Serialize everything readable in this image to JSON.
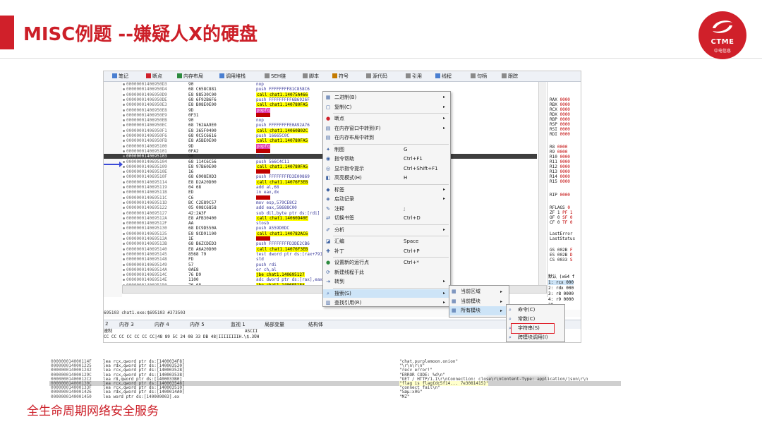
{
  "slide": {
    "title": "MISC例题 --嫌疑人X的硬盘",
    "footer": "全生命周期网络安全服务",
    "logo_name": "CTME",
    "logo_sub": "中电信息",
    "accent": "#cc1f28"
  },
  "toolbar": {
    "tabs": [
      {
        "label": "笔记",
        "color": "#4a7fd1"
      },
      {
        "label": "断点",
        "color": "#d0202a"
      },
      {
        "label": "内存布局",
        "color": "#2c8a3e"
      },
      {
        "label": "调用堆栈",
        "color": "#4a7fd1"
      },
      {
        "label": "SEH链",
        "color": "#8a8a8a"
      },
      {
        "label": "脚本",
        "color": "#8a8a8a"
      },
      {
        "label": "符号",
        "color": "#c47a00"
      },
      {
        "label": "源代码",
        "color": "#8a8a8a"
      },
      {
        "label": "引用",
        "color": "#8a8a8a"
      },
      {
        "label": "线程",
        "color": "#4a7fd1"
      },
      {
        "label": "句柄",
        "color": "#8a8a8a"
      },
      {
        "label": "跟踪",
        "color": "#8a8a8a"
      }
    ]
  },
  "disasm": {
    "rows": [
      {
        "addr": "00000001406950D3",
        "bytes": "90",
        "ins": "nop"
      },
      {
        "addr": "00000001406950D4",
        "bytes": "68 C658C881",
        "ins": "push FFFFFFFF81C858C6"
      },
      {
        "addr": "00000001406950D9",
        "bytes": "E8 88530C00",
        "ins": "call chat1.14075A466",
        "call": true
      },
      {
        "addr": "00000001406950DE",
        "bytes": "68 6F92B6F6",
        "ins": "push FFFFFFFFF6B6926F"
      },
      {
        "addr": "00000001406950E3",
        "bytes": "E8 B08E0E00",
        "ins": "call chat1.140780FA5",
        "call": true
      },
      {
        "addr": "00000001406950E8",
        "bytes": "9D",
        "ins": "popfq",
        "pop": true
      },
      {
        "addr": "00000001406950E9",
        "bytes": "0F31",
        "ins": "",
        "block": true
      },
      {
        "addr": "00000001406950EB",
        "bytes": "90",
        "ins": "nop"
      },
      {
        "addr": "00000001406950EC",
        "bytes": "68 762AA9E0",
        "ins": "push FFFFFFFFE0A92A76"
      },
      {
        "addr": "00000001406950F1",
        "bytes": "E8 365F0400",
        "ins": "call chat1.14060B02C",
        "call": true
      },
      {
        "addr": "00000001406950F6",
        "bytes": "68 0C5C6616",
        "ins": "push 16665C0C"
      },
      {
        "addr": "00000001406950FB",
        "bytes": "E8 A5BE0E00",
        "ins": "call chat1.140780FA5",
        "call": true
      },
      {
        "addr": "0000000140695100",
        "bytes": "9D",
        "ins": "popfq",
        "pop": true
      },
      {
        "addr": "0000000140695101",
        "bytes": "0FA2",
        "ins": "",
        "block": true
      },
      {
        "addr": "0000000140695103",
        "bytes": "90",
        "ins": "nop",
        "sel": true
      },
      {
        "addr": "0000000140695104",
        "bytes": "68 114C6C56",
        "ins": "push 566C4C11"
      },
      {
        "addr": "0000000140695109",
        "bytes": "E8 97B60E00",
        "ins": "call chat1.140780FA5",
        "call": true
      },
      {
        "addr": "000000014069510E",
        "bytes": "16",
        "ins": "",
        "block": true
      },
      {
        "addr": "000000014069510F",
        "bytes": "68 6908E0D3",
        "ins": "push FFFFFFFFD3E00869"
      },
      {
        "addr": "0000000140695114",
        "bytes": "E8 D2A20D00",
        "ins": "call chat1.14076F3EB",
        "call": true
      },
      {
        "addr": "0000000140695119",
        "bytes": "04 68",
        "ins": "add al,68"
      },
      {
        "addr": "000000014069511B",
        "bytes": "ED",
        "ins": "in eax,dx"
      },
      {
        "addr": "000000014069511C",
        "bytes": "C6",
        "ins": "",
        "block": true
      },
      {
        "addr": "000000014069511D",
        "bytes": "BC C2E89C57",
        "ins": "mov esp,579CE8C2"
      },
      {
        "addr": "0000000140695122",
        "bytes": "05 008C6858",
        "ins": "add eax,58688C00"
      },
      {
        "addr": "0000000140695127",
        "bytes": "42:2A3F",
        "ins": "sub dil,byte ptr ds:[rdi]"
      },
      {
        "addr": "000000014069512A",
        "bytes": "E8 AFB30400",
        "ins": "call chat1.14060D40E",
        "call": true
      },
      {
        "addr": "000000014069512F",
        "bytes": "AA",
        "ins": "stosb"
      },
      {
        "addr": "0000000140695130",
        "bytes": "68 DC9D550A",
        "ins": "push A559D0DC"
      },
      {
        "addr": "0000000140695135",
        "bytes": "E8 8CD91100",
        "ins": "call chat1.140782AC6",
        "call": true
      },
      {
        "addr": "000000014069513A",
        "bytes": "1E",
        "ins": "",
        "block": true
      },
      {
        "addr": "000000014069513B",
        "bytes": "68 B6ZCDED3",
        "ins": "push FFFFFFFFD3DE2CB6"
      },
      {
        "addr": "0000000140695140",
        "bytes": "E8 A6A20D00",
        "ins": "call chat1.14076F3EB",
        "call": true
      },
      {
        "addr": "0000000140695145",
        "bytes": "8568 79",
        "ins": "test dword ptr ds:[rax+79],ebp"
      },
      {
        "addr": "0000000140695148",
        "bytes": "FD",
        "ins": "std"
      },
      {
        "addr": "0000000140695149",
        "bytes": "57",
        "ins": "push rdi"
      },
      {
        "addr": "000000014069514A",
        "bytes": "0AE8",
        "ins": "or ch,al"
      },
      {
        "addr": "000000014069514C",
        "bytes": "76 D9",
        "ins": "jbe chat1.140695127",
        "jmp": true
      },
      {
        "addr": "000000014069514E",
        "bytes": "1100",
        "ins": "adc dword ptr ds:[rax],eax"
      },
      {
        "addr": "0000000140695150",
        "bytes": "76 68",
        "ins": "jbe chat1.14069518A",
        "jmp": true
      },
      {
        "addr": "0000000140695152",
        "bytes": "8A 17B7B6E8",
        "ins": "mov edx,E8B6B717"
      }
    ]
  },
  "regs": [
    {
      "name": "RAX",
      "val": "0000"
    },
    {
      "name": "RBX",
      "val": "0000"
    },
    {
      "name": "RCX",
      "val": "0000"
    },
    {
      "name": "RDX",
      "val": "0000"
    },
    {
      "name": "RBP",
      "val": "0000"
    },
    {
      "name": "RSP",
      "val": "0000"
    },
    {
      "name": "RSI",
      "val": "0000"
    },
    {
      "name": "RDI",
      "val": "0000"
    },
    {
      "name": "R8",
      "val": "0000"
    },
    {
      "name": "R9",
      "val": "0000"
    },
    {
      "name": "R10",
      "val": "0000"
    },
    {
      "name": "R11",
      "val": "0000"
    },
    {
      "name": "R12",
      "val": "0000"
    },
    {
      "name": "R13",
      "val": "0000"
    },
    {
      "name": "R14",
      "val": "0000"
    },
    {
      "name": "R15",
      "val": "0000"
    },
    {
      "name": "RIP",
      "val": "0000"
    },
    {
      "name": "RFLAGS",
      "val": "0"
    },
    {
      "name": "ZF 1",
      "val": "PF 1"
    },
    {
      "name": "OF 0",
      "val": "SF 0"
    },
    {
      "name": "CF 0",
      "val": "TF 0"
    },
    {
      "name": "LastError",
      "val": ""
    },
    {
      "name": "LastStatus",
      "val": ""
    },
    {
      "name": "GS 002B",
      "val": "F"
    },
    {
      "name": "ES 002B",
      "val": "D"
    },
    {
      "name": "CS 0033",
      "val": "S"
    }
  ],
  "stack": [
    "默认 (x64 f",
    "1: rcx 000",
    "2: rdx 000",
    "3: r8 0000",
    "4: r9 0000",
    "28"
  ],
  "status": "695103 chat1.exe:$695103 #373503",
  "bottom_tabs": [
    "2",
    "内存 3",
    "内存 4",
    "内存 5",
    "监视 1",
    "局部变量",
    "结构体"
  ],
  "dump": {
    "header_left": "速制",
    "header_right": "ASCII",
    "line": "CC CC CC CC CC CC CC|48 89 5C 24 08 33 DB 48|IIIIIIIIH.\\$.3ÛH"
  },
  "menu": {
    "items": [
      {
        "icon": "▦",
        "label": "二进制(B)",
        "shortcut": "",
        "arrow": true
      },
      {
        "icon": "▢",
        "label": "复制(C)",
        "shortcut": "",
        "arrow": true
      },
      {
        "icon": "●",
        "label": "断点",
        "shortcut": "",
        "arrow": true,
        "iconColor": "#d0202a"
      },
      {
        "icon": "▤",
        "label": "在内存窗口中转到(F)",
        "shortcut": "",
        "arrow": true
      },
      {
        "icon": "▤",
        "label": "在内存布局中转到",
        "shortcut": "",
        "arrow": false
      },
      {
        "icon": "✦",
        "label": "制图",
        "shortcut": "G",
        "arrow": false
      },
      {
        "icon": "◉",
        "label": "指令帮助",
        "shortcut": "Ctrl+F1",
        "arrow": false
      },
      {
        "icon": "◎",
        "label": "显示指令提示",
        "shortcut": "Ctrl+Shift+F1",
        "arrow": false
      },
      {
        "icon": "◧",
        "label": "高亮模式(H)",
        "shortcut": "H",
        "arrow": false
      },
      {
        "icon": "◆",
        "label": "标签",
        "shortcut": "",
        "arrow": true
      },
      {
        "icon": "◈",
        "label": "启动记录",
        "shortcut": "",
        "arrow": true
      },
      {
        "icon": "✎",
        "label": "注释",
        "shortcut": ";",
        "arrow": false
      },
      {
        "icon": "⇄",
        "label": "切换书签",
        "shortcut": "Ctrl+D",
        "arrow": false
      },
      {
        "icon": "✐",
        "label": "分析",
        "shortcut": "",
        "arrow": true
      },
      {
        "icon": "◪",
        "label": "汇编",
        "shortcut": "Space",
        "arrow": false
      },
      {
        "icon": "✚",
        "label": "补丁",
        "shortcut": "Ctrl+P",
        "arrow": false
      },
      {
        "icon": "●",
        "label": "设置新的运行点",
        "shortcut": "Ctrl+*",
        "arrow": false,
        "iconColor": "#2c8a3e"
      },
      {
        "icon": "⟳",
        "label": "新建线程于此",
        "shortcut": "",
        "arrow": false
      },
      {
        "icon": "⇥",
        "label": "转到",
        "shortcut": "",
        "arrow": true
      },
      {
        "icon": "⌕",
        "label": "搜索(S)",
        "shortcut": "",
        "arrow": true,
        "hl": true
      },
      {
        "icon": "▥",
        "label": "查找引用(R)",
        "shortcut": "",
        "arrow": true
      }
    ]
  },
  "submenu1": {
    "items": [
      {
        "label": "当前区域",
        "arrow": true
      },
      {
        "label": "当前模块",
        "arrow": true
      },
      {
        "label": "所有模块",
        "arrow": true,
        "hl": true
      }
    ]
  },
  "submenu2": {
    "items": [
      {
        "label": "命令(C)"
      },
      {
        "label": "常数(C)"
      },
      {
        "label": "字符串(S)"
      },
      {
        "label": "跨模块调用(I)"
      }
    ]
  },
  "strings": {
    "rows": [
      {
        "addr": "000000014000114F",
        "ins": "lea rcx,qword ptr ds:[1400034F8]",
        "str": "\"chat.purplemoon.onion\""
      },
      {
        "addr": "0000000140001225",
        "ins": "lea rdx,qword ptr ds:[140003520]",
        "str": "\"\\r\\n\\r\\n\""
      },
      {
        "addr": "0000000140001242",
        "ins": "lea rcx,qword ptr ds:[140003528]",
        "str": "\"recv error!\""
      },
      {
        "addr": "000000014000129C",
        "ins": "lea rcx,qword ptr ds:[140003538]",
        "str": "\"ERROR CODE: %d\\n\""
      },
      {
        "addr": "00000001400012C2",
        "ins": "lea r8,qword ptr ds:[1400033B0]",
        "str": "\"GET / HTTP/1.1\\r\\nConnection: close\\r\\nContent-Type: application/json\\r\\n"
      },
      {
        "addr": "000000014000130C",
        "ins": "lea rcx,qword ptr ds:[140003548]",
        "str": "\"flag is flag{dc5f14...                 7e3081415}\"",
        "hl": true
      },
      {
        "addr": "000000014000133F",
        "ins": "lea rcx,qword ptr ds:[140003510]",
        "str": "\"connect fail\\n\""
      },
      {
        "addr": "0000000140001426",
        "ins": "lea rdx,qword ptr ds:[1400014A0]",
        "str": "\"5æµ:x0G\""
      },
      {
        "addr": "0000000140001450",
        "ins": "lea word ptr ds:[140000003].ex",
        "str": "\"MZ\""
      }
    ]
  }
}
